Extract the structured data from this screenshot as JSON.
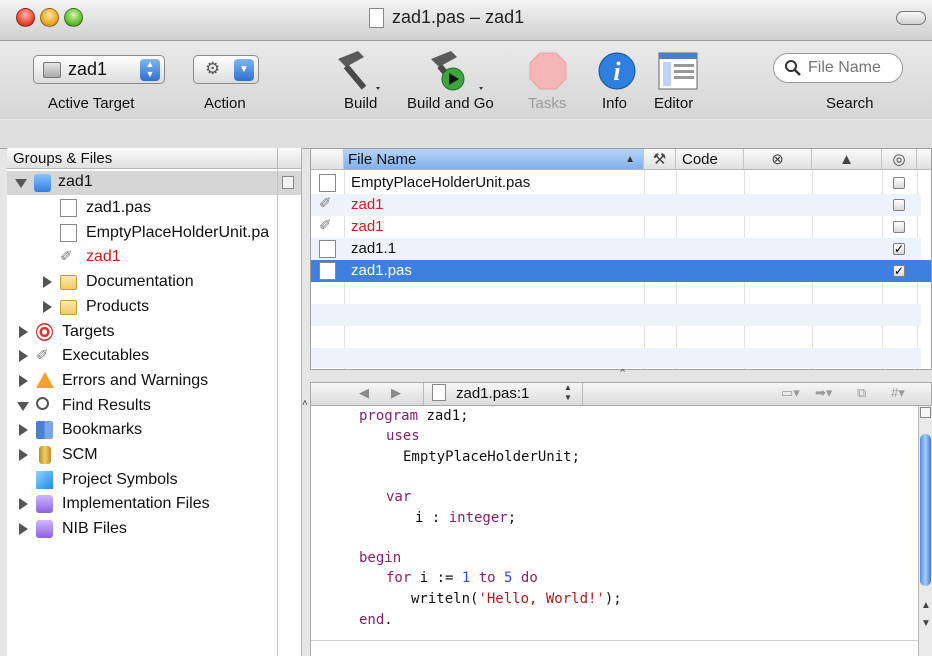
{
  "window": {
    "title": "zad1.pas – zad1"
  },
  "toolbar": {
    "active_target_value": "zad1",
    "active_target_label": "Active Target",
    "action_label": "Action",
    "build_label": "Build",
    "build_and_go_label": "Build and Go",
    "tasks_label": "Tasks",
    "info_label": "Info",
    "editor_label": "Editor",
    "search_label": "Search",
    "search_placeholder": "File Name"
  },
  "sidebar": {
    "header": "Groups & Files",
    "items": [
      {
        "label": "zad1",
        "icon": "project-icon"
      },
      {
        "label": "zad1.pas",
        "icon": "document-icon"
      },
      {
        "label": "EmptyPlaceHolderUnit.pa",
        "icon": "document-icon"
      },
      {
        "label": "zad1",
        "icon": "executable-icon"
      },
      {
        "label": "Documentation",
        "icon": "folder-icon"
      },
      {
        "label": "Products",
        "icon": "folder-icon"
      },
      {
        "label": "Targets",
        "icon": "target-icon"
      },
      {
        "label": "Executables",
        "icon": "executable-icon"
      },
      {
        "label": "Errors and Warnings",
        "icon": "warning-icon"
      },
      {
        "label": "Find Results",
        "icon": "magnifier-icon"
      },
      {
        "label": "Bookmarks",
        "icon": "bookmark-icon"
      },
      {
        "label": "SCM",
        "icon": "scm-icon"
      },
      {
        "label": "Project Symbols",
        "icon": "symbols-icon"
      },
      {
        "label": "Implementation Files",
        "icon": "smart-group-icon"
      },
      {
        "label": "NIB Files",
        "icon": "smart-group-icon"
      }
    ]
  },
  "files": {
    "columns": [
      "File Name",
      "Code"
    ],
    "rows": [
      {
        "name": "EmptyPlaceHolderUnit.pas",
        "checked": false
      },
      {
        "name": "zad1",
        "checked": false
      },
      {
        "name": "zad1",
        "checked": false
      },
      {
        "name": "zad1.1",
        "checked": true
      },
      {
        "name": "zad1.pas",
        "checked": true
      }
    ]
  },
  "editor": {
    "file_popup": "zad1.pas:1",
    "code": {
      "l1_kw": "program",
      "l1_rest": " zad1;",
      "l2_kw": "uses",
      "l3": "EmptyPlaceHolderUnit;",
      "l4_kw": "var",
      "l5_a": "i : ",
      "l5_kw": "integer",
      "l5_b": ";",
      "l6_kw": "begin",
      "l7_kw1": "for",
      "l7_a": " i := ",
      "l7_n1": "1",
      "l7_kw2": " to ",
      "l7_n2": "5",
      "l7_kw3": " do",
      "l8_a": "writeln(",
      "l8_str": "'Hello, World!'",
      "l8_b": ");",
      "l9_kw": "end",
      "l9_b": "."
    }
  },
  "colors": {
    "selection": "#3d80df",
    "error_text": "#d41c1c",
    "keyword": "#8a1f6b"
  }
}
